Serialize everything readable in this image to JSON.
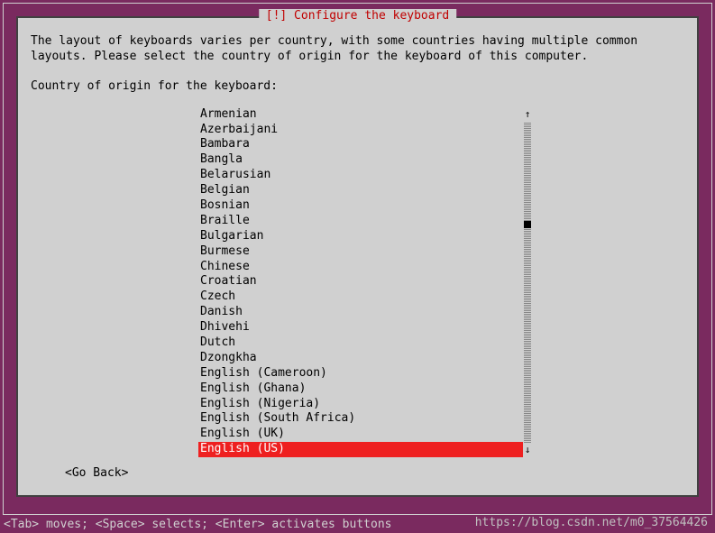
{
  "title": "[!] Configure the keyboard",
  "instructions": "The layout of keyboards varies per country, with some countries having multiple common\nlayouts. Please select the country of origin for the keyboard of this computer.",
  "prompt": "Country of origin for the keyboard:",
  "items": [
    "Armenian",
    "Azerbaijani",
    "Bambara",
    "Bangla",
    "Belarusian",
    "Belgian",
    "Bosnian",
    "Braille",
    "Bulgarian",
    "Burmese",
    "Chinese",
    "Croatian",
    "Czech",
    "Danish",
    "Dhivehi",
    "Dutch",
    "Dzongkha",
    "English (Cameroon)",
    "English (Ghana)",
    "English (Nigeria)",
    "English (South Africa)",
    "English (UK)",
    "English (US)"
  ],
  "selected_index": 22,
  "go_back": "<Go Back>",
  "footer": "<Tab> moves; <Space> selects; <Enter> activates buttons",
  "watermark": "https://blog.csdn.net/m0_37564426",
  "scroll": {
    "thumb_top_pct": 31
  }
}
